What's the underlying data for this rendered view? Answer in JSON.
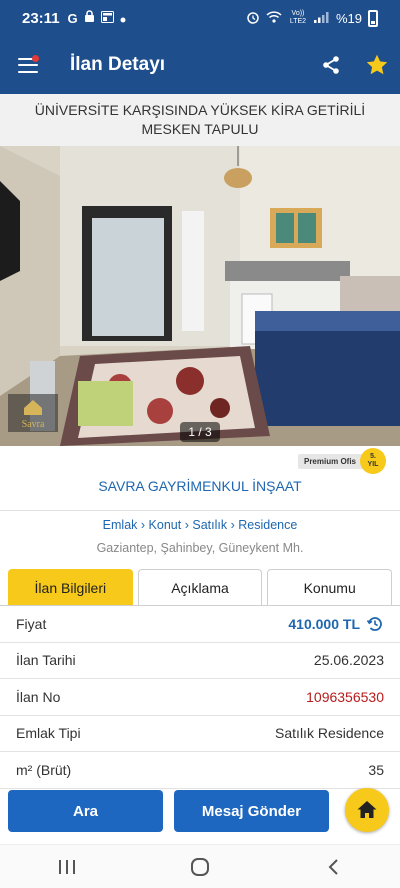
{
  "status_bar": {
    "time": "23:11",
    "left_icons": [
      "google-icon",
      "lock-icon",
      "news-icon",
      "dot-icon"
    ],
    "network_text": "Vo)) LTE2",
    "battery_text": "%19"
  },
  "app_bar": {
    "title": "İlan Detayı",
    "menu_badge_color": "#e53935"
  },
  "listing": {
    "title": "ÜNİVERSİTE KARŞISINDA YÜKSEK KİRA GETİRİLİ MESKEN TAPULU",
    "photo_counter": "1 / 3",
    "watermark_text": "Savra"
  },
  "premium": {
    "label": "Premium Ofis",
    "years_num": "5.",
    "years_label": "YIL"
  },
  "store_name": "SAVRA GAYRİMENKUL İNŞAAT",
  "breadcrumb": {
    "items": [
      "Emlak",
      "Konut",
      "Satılık",
      "Residence"
    ],
    "separator": "›"
  },
  "location": "Gaziantep, Şahinbey, Güneykent Mh.",
  "tabs": [
    {
      "label": "İlan Bilgileri",
      "active": true
    },
    {
      "label": "Açıklama",
      "active": false
    },
    {
      "label": "Konumu",
      "active": false
    }
  ],
  "info_rows": [
    {
      "key": "Fiyat",
      "value": "410.000 TL"
    },
    {
      "key": "İlan Tarihi",
      "value": "25.06.2023"
    },
    {
      "key": "İlan No",
      "value": "1096356530"
    },
    {
      "key": "Emlak Tipi",
      "value": "Satılık Residence"
    },
    {
      "key": "m² (Brüt)",
      "value": "35"
    }
  ],
  "buttons": {
    "call": "Ara",
    "message": "Mesaj Gönder"
  },
  "colors": {
    "primary": "#1f4e8c",
    "accent_yellow": "#f6c91a",
    "link_blue": "#1e67b0",
    "button_blue": "#1e67c0",
    "id_red": "#b71c1c"
  }
}
